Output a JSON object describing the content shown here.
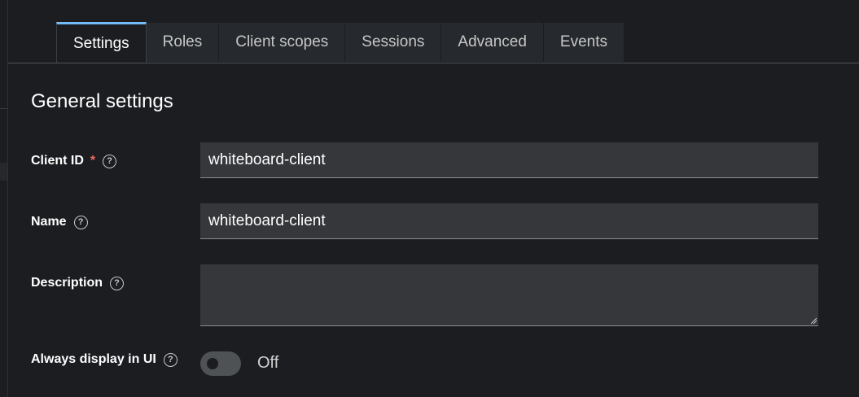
{
  "tabs": [
    {
      "label": "Settings"
    },
    {
      "label": "Roles"
    },
    {
      "label": "Client scopes"
    },
    {
      "label": "Sessions"
    },
    {
      "label": "Advanced"
    },
    {
      "label": "Events"
    }
  ],
  "section": {
    "title": "General settings"
  },
  "fields": {
    "client_id": {
      "label": "Client ID",
      "required_mark": "*",
      "value": "whiteboard-client"
    },
    "name": {
      "label": "Name",
      "value": "whiteboard-client"
    },
    "description": {
      "label": "Description",
      "value": ""
    },
    "always_display": {
      "label": "Always display in UI",
      "state": "Off"
    }
  },
  "help_glyph": "?",
  "colors": {
    "active_tab_accent": "#73bcf7",
    "required": "#f06b62",
    "input_bg": "#36373b"
  }
}
